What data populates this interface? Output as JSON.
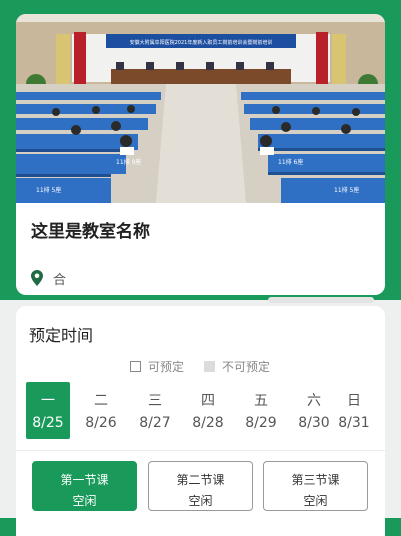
{
  "room": {
    "banner_text": "安徽大附属阜阳医院2021年度新入职员工岗前培训会暨岗前培训",
    "title": "这里是教室名称",
    "location": "合",
    "location_icon": "map-pin-icon",
    "seat_labels": [
      "11排 5座",
      "11排 9座",
      "11排 6座",
      "11排 5座"
    ]
  },
  "booking": {
    "section_title": "预定时间",
    "legend_available": "可预定",
    "legend_unavailable": "不可预定",
    "days": [
      {
        "weekday": "一",
        "date": "8/25",
        "selected": true
      },
      {
        "weekday": "二",
        "date": "8/26",
        "selected": false
      },
      {
        "weekday": "三",
        "date": "8/27",
        "selected": false
      },
      {
        "weekday": "四",
        "date": "8/28",
        "selected": false
      },
      {
        "weekday": "五",
        "date": "8/29",
        "selected": false
      },
      {
        "weekday": "六",
        "date": "8/30",
        "selected": false
      },
      {
        "weekday": "日",
        "date": "8/31",
        "selected": false
      }
    ],
    "slots": [
      {
        "name": "第一节课",
        "status": "空闲",
        "selected": true
      },
      {
        "name": "第二节课",
        "status": "空闲",
        "selected": false
      },
      {
        "name": "第三节课",
        "status": "空闲",
        "selected": false
      }
    ]
  },
  "colors": {
    "accent": "#1a9a5a",
    "background": "#eef0ef",
    "card": "#ffffff"
  }
}
